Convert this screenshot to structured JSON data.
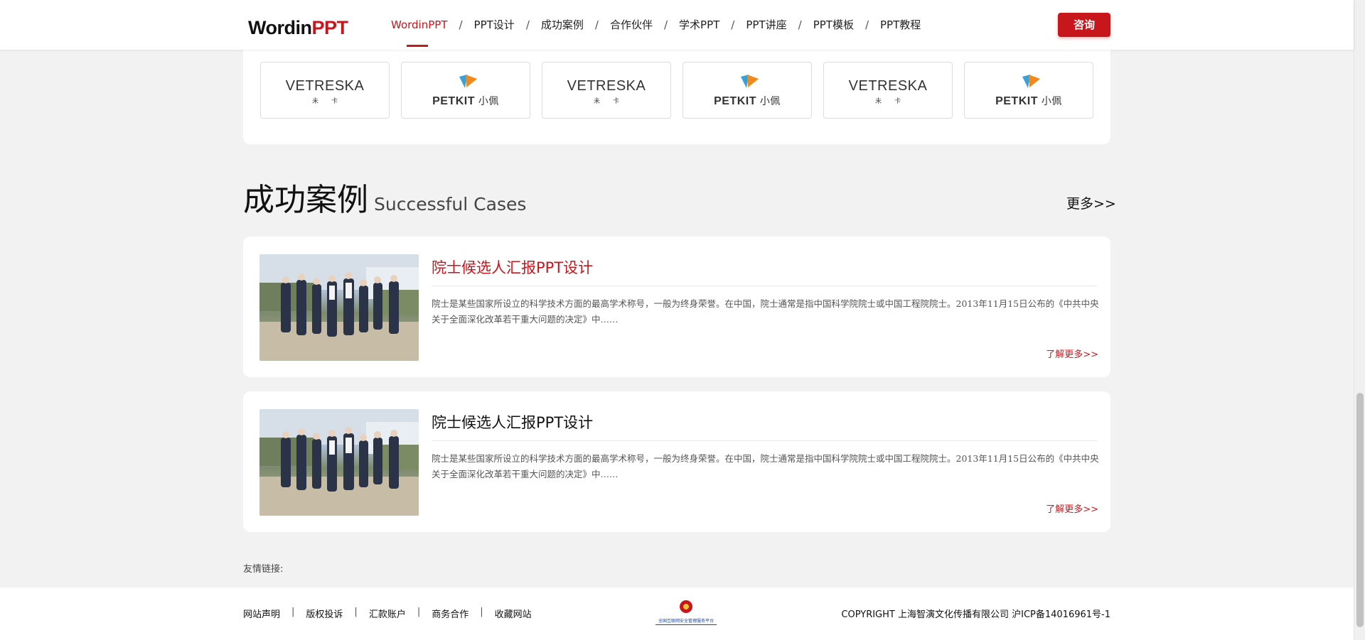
{
  "header": {
    "logo": {
      "word": "Wordin",
      "ppt": "PPT"
    },
    "nav": [
      {
        "label": "WordinPPT",
        "active": true
      },
      {
        "label": "PPT设计"
      },
      {
        "label": "成功案例"
      },
      {
        "label": "合作伙伴"
      },
      {
        "label": "学术PPT"
      },
      {
        "label": "PPT讲座"
      },
      {
        "label": "PPT模板"
      },
      {
        "label": "PPT教程"
      }
    ],
    "separator": "/",
    "consult_label": "咨询"
  },
  "partners": [
    {
      "kind": "vetreska",
      "name": "VETRESKA",
      "sub": "未卡"
    },
    {
      "kind": "petkit",
      "name": "PETKIT",
      "cn": "小佩"
    },
    {
      "kind": "vetreska",
      "name": "VETRESKA",
      "sub": "未卡"
    },
    {
      "kind": "petkit",
      "name": "PETKIT",
      "cn": "小佩"
    },
    {
      "kind": "vetreska",
      "name": "VETRESKA",
      "sub": "未卡"
    },
    {
      "kind": "petkit",
      "name": "PETKIT",
      "cn": "小佩"
    }
  ],
  "cases_section": {
    "title_cn": "成功案例",
    "title_en": "Successful Cases",
    "more": "更多>>",
    "items": [
      {
        "title": "院士候选人汇报PPT设计",
        "desc": "院士是某些国家所设立的科学技术方面的最高学术称号，一般为终身荣誉。在中国，院士通常是指中国科学院院士或中国工程院院士。2013年11月15日公布的《中共中央关于全面深化改革若干重大问题的决定》中……",
        "learn_more": "了解更多>>",
        "highlight": true
      },
      {
        "title": "院士候选人汇报PPT设计",
        "desc": "院士是某些国家所设立的科学技术方面的最高学术称号，一般为终身荣誉。在中国，院士通常是指中国科学院院士或中国工程院院士。2013年11月15日公布的《中共中央关于全面深化改革若干重大问题的决定》中……",
        "learn_more": "了解更多>>",
        "highlight": false
      }
    ]
  },
  "friend_links_label": "友情链接:",
  "footer": {
    "links": [
      "网站声明",
      "版权投诉",
      "汇款账户",
      "商务合作",
      "收藏网站"
    ],
    "separator": "|",
    "badge_text": "全国互联网安全管理服务平台",
    "copyright": "COPYRIGHT 上海智演文化传播有限公司 沪ICP备14016961号-1"
  },
  "colors": {
    "brand": "#c8161d",
    "background": "#f2f2f2"
  }
}
